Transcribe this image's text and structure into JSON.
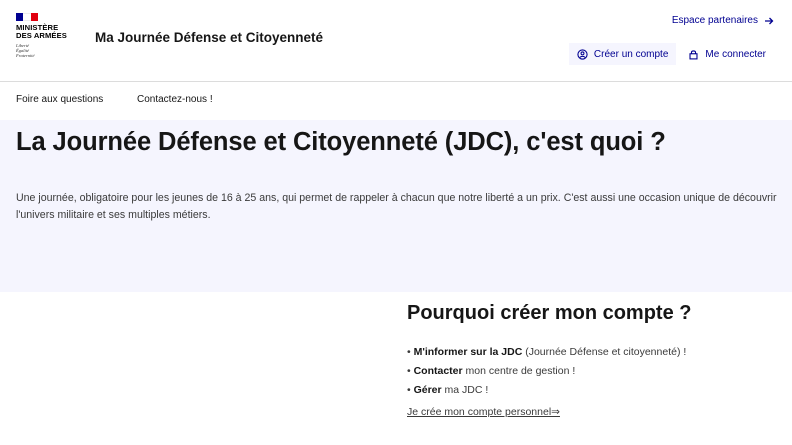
{
  "header": {
    "logo": {
      "line1": "MINISTÈRE",
      "line2": "DES ARMÉES",
      "motto": [
        "Liberté",
        "Égalité",
        "Fraternité"
      ],
      "flag_colors": [
        "#000091",
        "#ffffff",
        "#e1000f"
      ]
    },
    "site_title": "Ma Journée Défense et Citoyenneté",
    "partners_link": "Espace partenaires",
    "tools": {
      "create_account": "Créer un compte",
      "login": "Me connecter"
    }
  },
  "nav": {
    "items": [
      "Foire aux questions",
      "Contactez-nous !"
    ]
  },
  "hero": {
    "title": "La Journée Défense et Citoyenneté (JDC), c'est quoi ?",
    "text": "Une journée, obligatoire pour les jeunes de 16 à 25 ans, qui permet de rappeler à chacun que notre liberté a un prix. C'est aussi une occasion unique de découvrir l'univers militaire et ses multiples métiers."
  },
  "why": {
    "title": "Pourquoi créer mon compte ?",
    "items": [
      {
        "bold": "M'informer sur la JDC",
        "rest": " (Journée Défense et citoyenneté) !"
      },
      {
        "bold": "Contacter",
        "rest": " mon centre de gestion !"
      },
      {
        "bold": "Gérer",
        "rest": " ma JDC !"
      }
    ],
    "cta": "Je crée mon compte personnel⇒"
  },
  "colors": {
    "primary_blue": "#000091",
    "hero_background": "#f5f5fe",
    "text_default": "#161616"
  }
}
